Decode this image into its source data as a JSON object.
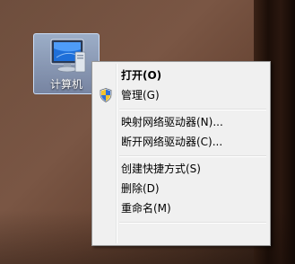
{
  "desktop": {
    "icon_label": "计算机",
    "icon_name": "computer-icon"
  },
  "context_menu": {
    "items": [
      {
        "label": "打开(O)",
        "bold": true
      },
      {
        "label": "管理(G)",
        "icon": "uac-shield-icon"
      },
      {
        "label": "映射网络驱动器(N)..."
      },
      {
        "label": "断开网络驱动器(C)..."
      },
      {
        "label": "创建快捷方式(S)"
      },
      {
        "label": "删除(D)"
      },
      {
        "label": "重命名(M)"
      }
    ]
  },
  "colors": {
    "menu_background": "#f0f0f0",
    "menu_border": "#979797",
    "icon_selection": "#9fc4ee"
  }
}
